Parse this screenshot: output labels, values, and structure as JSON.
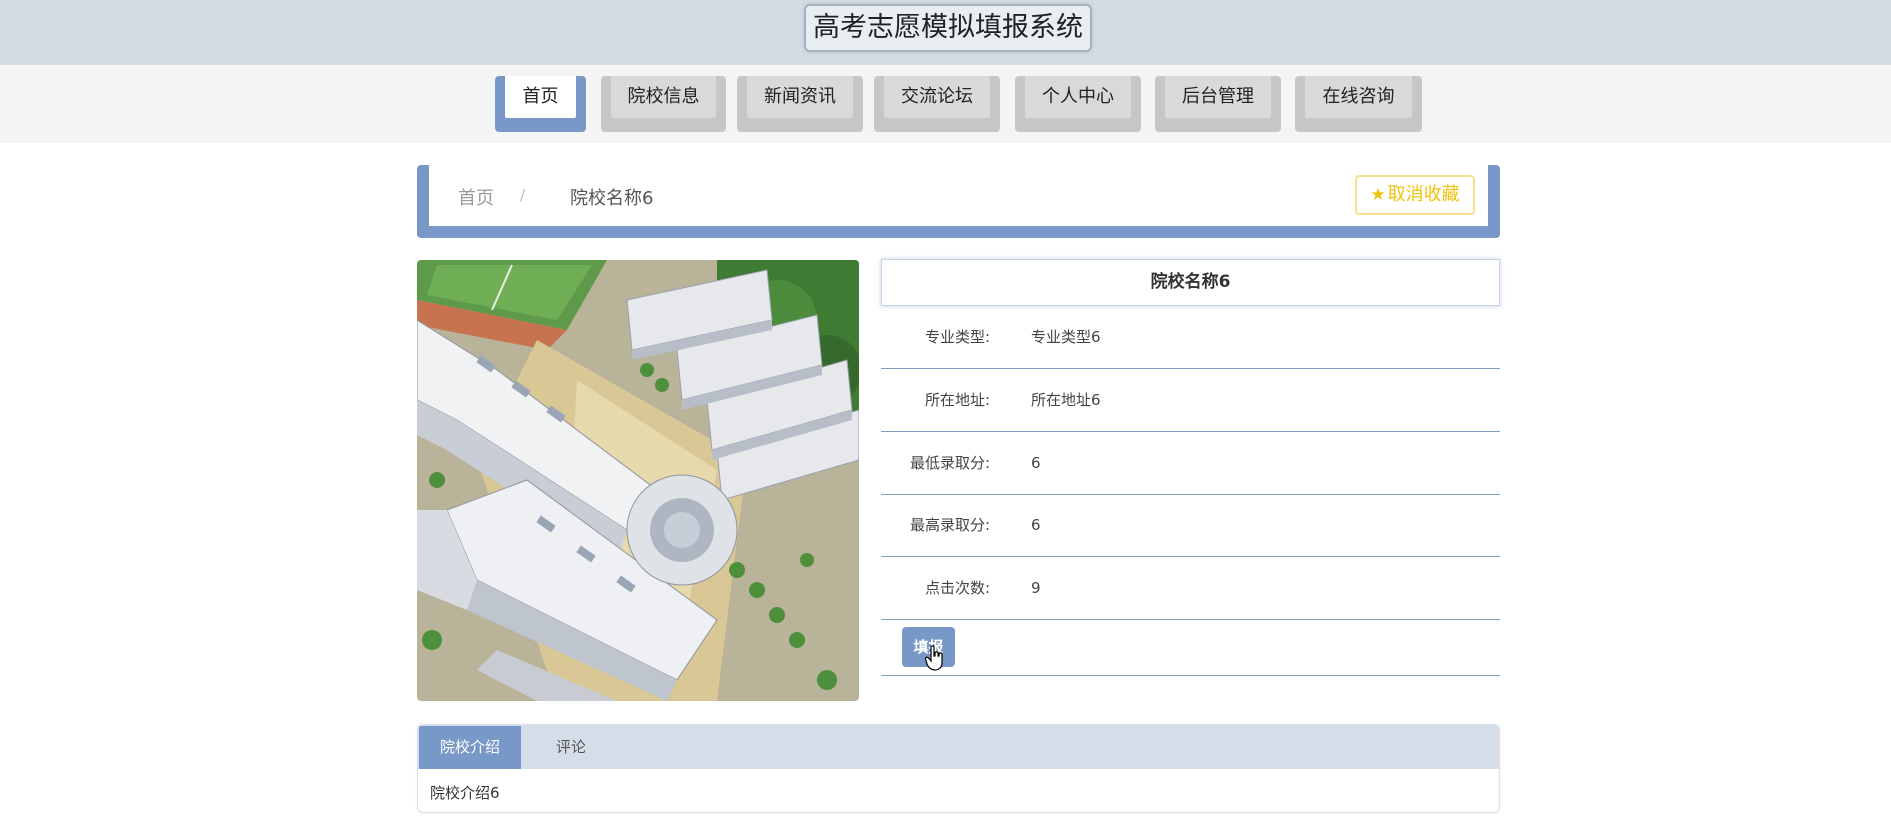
{
  "header": {
    "title": "高考志愿模拟填报系统"
  },
  "nav": {
    "items": [
      {
        "label": "首页",
        "active": true
      },
      {
        "label": "院校信息",
        "active": false
      },
      {
        "label": "新闻资讯",
        "active": false
      },
      {
        "label": "交流论坛",
        "active": false
      },
      {
        "label": "个人中心",
        "active": false
      },
      {
        "label": "后台管理",
        "active": false
      },
      {
        "label": "在线咨询",
        "active": false
      }
    ]
  },
  "breadcrumb": {
    "home": "首页",
    "separator": "/",
    "current": "院校名称6"
  },
  "favorite": {
    "label": "取消收藏",
    "icon": "star-icon"
  },
  "school": {
    "name": "院校名称6",
    "fields": [
      {
        "label": "专业类型:",
        "value": "专业类型6"
      },
      {
        "label": "所在地址:",
        "value": "所在地址6"
      },
      {
        "label": "最低录取分:",
        "value": "6"
      },
      {
        "label": "最高录取分:",
        "value": "6"
      },
      {
        "label": "点击次数:",
        "value": "9"
      }
    ],
    "apply_label": "填报"
  },
  "tabs": {
    "items": [
      {
        "label": "院校介绍",
        "active": true
      },
      {
        "label": "评论",
        "active": false
      }
    ],
    "content": "院校介绍6"
  },
  "colors": {
    "accent": "#7899c7",
    "header_bg": "#d4dde6",
    "favorite": "#f0c20c"
  }
}
